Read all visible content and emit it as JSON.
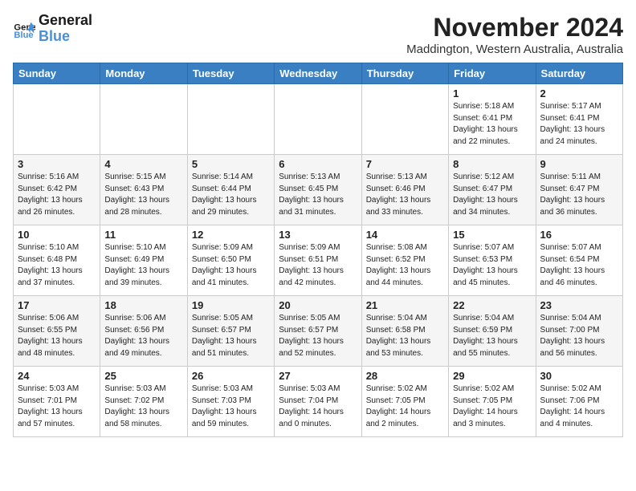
{
  "header": {
    "logo_line1": "General",
    "logo_line2": "Blue",
    "month": "November 2024",
    "location": "Maddington, Western Australia, Australia"
  },
  "days_of_week": [
    "Sunday",
    "Monday",
    "Tuesday",
    "Wednesday",
    "Thursday",
    "Friday",
    "Saturday"
  ],
  "weeks": [
    [
      {
        "day": "",
        "info": ""
      },
      {
        "day": "",
        "info": ""
      },
      {
        "day": "",
        "info": ""
      },
      {
        "day": "",
        "info": ""
      },
      {
        "day": "",
        "info": ""
      },
      {
        "day": "1",
        "info": "Sunrise: 5:18 AM\nSunset: 6:41 PM\nDaylight: 13 hours\nand 22 minutes."
      },
      {
        "day": "2",
        "info": "Sunrise: 5:17 AM\nSunset: 6:41 PM\nDaylight: 13 hours\nand 24 minutes."
      }
    ],
    [
      {
        "day": "3",
        "info": "Sunrise: 5:16 AM\nSunset: 6:42 PM\nDaylight: 13 hours\nand 26 minutes."
      },
      {
        "day": "4",
        "info": "Sunrise: 5:15 AM\nSunset: 6:43 PM\nDaylight: 13 hours\nand 28 minutes."
      },
      {
        "day": "5",
        "info": "Sunrise: 5:14 AM\nSunset: 6:44 PM\nDaylight: 13 hours\nand 29 minutes."
      },
      {
        "day": "6",
        "info": "Sunrise: 5:13 AM\nSunset: 6:45 PM\nDaylight: 13 hours\nand 31 minutes."
      },
      {
        "day": "7",
        "info": "Sunrise: 5:13 AM\nSunset: 6:46 PM\nDaylight: 13 hours\nand 33 minutes."
      },
      {
        "day": "8",
        "info": "Sunrise: 5:12 AM\nSunset: 6:47 PM\nDaylight: 13 hours\nand 34 minutes."
      },
      {
        "day": "9",
        "info": "Sunrise: 5:11 AM\nSunset: 6:47 PM\nDaylight: 13 hours\nand 36 minutes."
      }
    ],
    [
      {
        "day": "10",
        "info": "Sunrise: 5:10 AM\nSunset: 6:48 PM\nDaylight: 13 hours\nand 37 minutes."
      },
      {
        "day": "11",
        "info": "Sunrise: 5:10 AM\nSunset: 6:49 PM\nDaylight: 13 hours\nand 39 minutes."
      },
      {
        "day": "12",
        "info": "Sunrise: 5:09 AM\nSunset: 6:50 PM\nDaylight: 13 hours\nand 41 minutes."
      },
      {
        "day": "13",
        "info": "Sunrise: 5:09 AM\nSunset: 6:51 PM\nDaylight: 13 hours\nand 42 minutes."
      },
      {
        "day": "14",
        "info": "Sunrise: 5:08 AM\nSunset: 6:52 PM\nDaylight: 13 hours\nand 44 minutes."
      },
      {
        "day": "15",
        "info": "Sunrise: 5:07 AM\nSunset: 6:53 PM\nDaylight: 13 hours\nand 45 minutes."
      },
      {
        "day": "16",
        "info": "Sunrise: 5:07 AM\nSunset: 6:54 PM\nDaylight: 13 hours\nand 46 minutes."
      }
    ],
    [
      {
        "day": "17",
        "info": "Sunrise: 5:06 AM\nSunset: 6:55 PM\nDaylight: 13 hours\nand 48 minutes."
      },
      {
        "day": "18",
        "info": "Sunrise: 5:06 AM\nSunset: 6:56 PM\nDaylight: 13 hours\nand 49 minutes."
      },
      {
        "day": "19",
        "info": "Sunrise: 5:05 AM\nSunset: 6:57 PM\nDaylight: 13 hours\nand 51 minutes."
      },
      {
        "day": "20",
        "info": "Sunrise: 5:05 AM\nSunset: 6:57 PM\nDaylight: 13 hours\nand 52 minutes."
      },
      {
        "day": "21",
        "info": "Sunrise: 5:04 AM\nSunset: 6:58 PM\nDaylight: 13 hours\nand 53 minutes."
      },
      {
        "day": "22",
        "info": "Sunrise: 5:04 AM\nSunset: 6:59 PM\nDaylight: 13 hours\nand 55 minutes."
      },
      {
        "day": "23",
        "info": "Sunrise: 5:04 AM\nSunset: 7:00 PM\nDaylight: 13 hours\nand 56 minutes."
      }
    ],
    [
      {
        "day": "24",
        "info": "Sunrise: 5:03 AM\nSunset: 7:01 PM\nDaylight: 13 hours\nand 57 minutes."
      },
      {
        "day": "25",
        "info": "Sunrise: 5:03 AM\nSunset: 7:02 PM\nDaylight: 13 hours\nand 58 minutes."
      },
      {
        "day": "26",
        "info": "Sunrise: 5:03 AM\nSunset: 7:03 PM\nDaylight: 13 hours\nand 59 minutes."
      },
      {
        "day": "27",
        "info": "Sunrise: 5:03 AM\nSunset: 7:04 PM\nDaylight: 14 hours\nand 0 minutes."
      },
      {
        "day": "28",
        "info": "Sunrise: 5:02 AM\nSunset: 7:05 PM\nDaylight: 14 hours\nand 2 minutes."
      },
      {
        "day": "29",
        "info": "Sunrise: 5:02 AM\nSunset: 7:05 PM\nDaylight: 14 hours\nand 3 minutes."
      },
      {
        "day": "30",
        "info": "Sunrise: 5:02 AM\nSunset: 7:06 PM\nDaylight: 14 hours\nand 4 minutes."
      }
    ]
  ]
}
